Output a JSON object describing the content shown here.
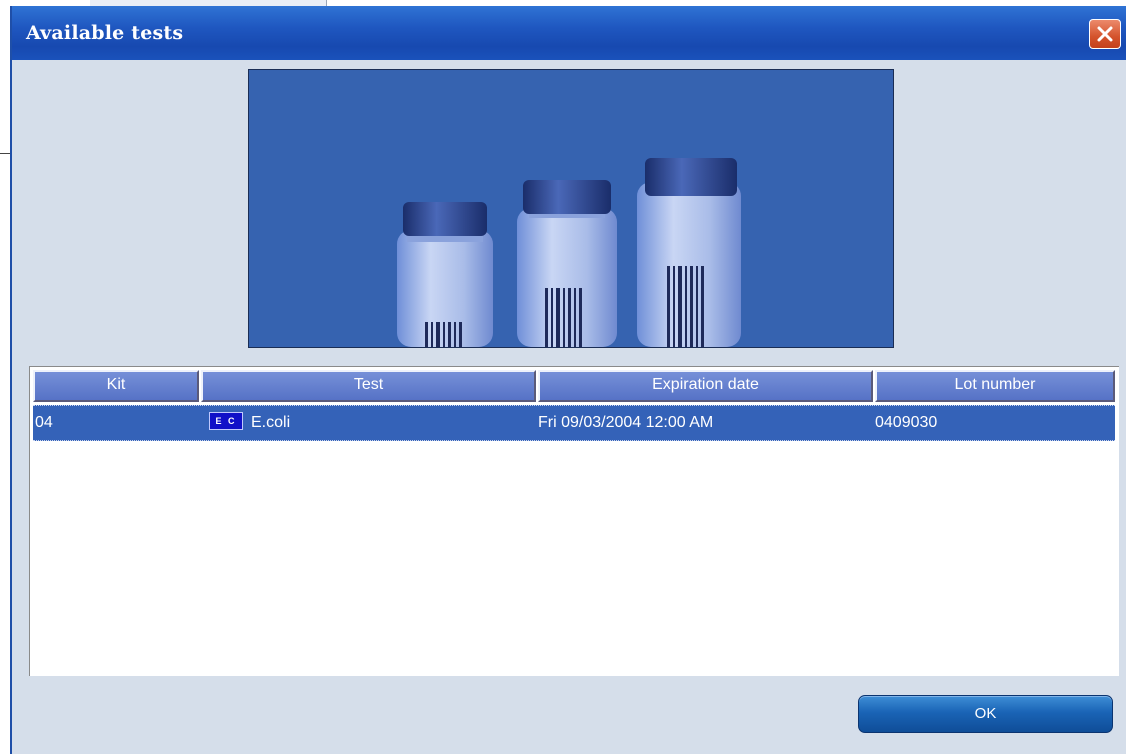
{
  "dialog": {
    "title": "Available tests",
    "close_icon": "close-x-icon"
  },
  "image": {
    "description_icon": "vials-image"
  },
  "table": {
    "columns": [
      "Kit",
      "Test",
      "Expiration date",
      "Lot number"
    ],
    "rows": [
      {
        "kit": "04",
        "test_icon_label": "E C",
        "test": "E.coli",
        "expiration_date": "Fri 09/03/2004 12:00 AM",
        "lot_number": "0409030",
        "selected": true
      }
    ]
  },
  "buttons": {
    "ok_label": "OK"
  },
  "colors": {
    "titlebar": "#1f57c0",
    "dialog_bg": "#d5deea",
    "header_bg": "#6680d0",
    "selected_row": "#3462b8",
    "ok_button": "#1a64b6",
    "close_button": "#d4532c"
  }
}
